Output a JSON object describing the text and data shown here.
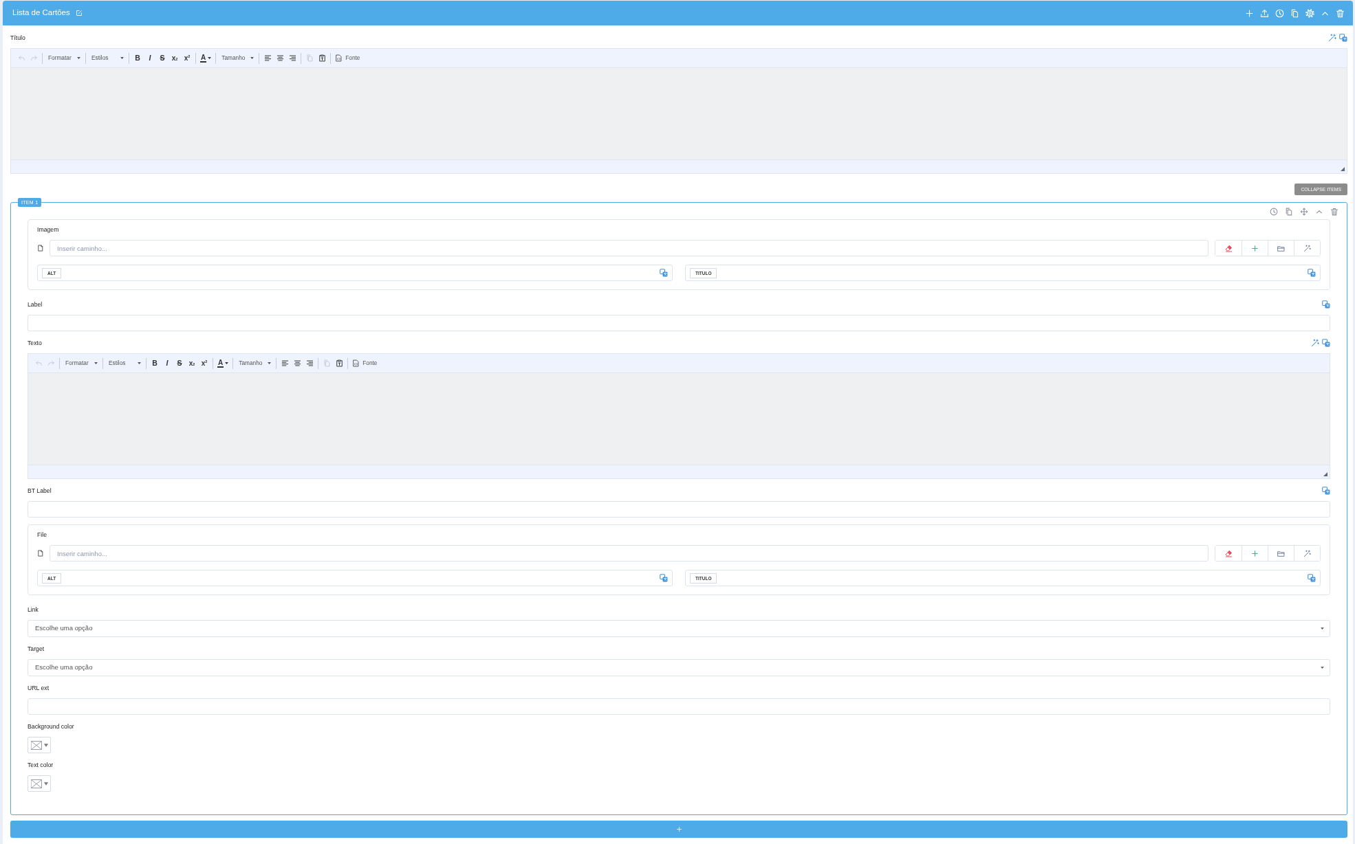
{
  "panel": {
    "title": "Lista de Cartões"
  },
  "title_field": {
    "label": "Título",
    "wand": true,
    "translate": true,
    "editor": {
      "toolbar": [
        [
          {
            "kind": "undo",
            "disabled": true
          },
          {
            "kind": "redo",
            "disabled": true
          }
        ],
        [
          {
            "kind": "combo",
            "label": "Formatar",
            "disabled": false
          }
        ],
        [
          {
            "kind": "combo",
            "label": "Estilos",
            "disabled": false
          }
        ],
        [
          {
            "kind": "bold",
            "text": "B",
            "disabled": false
          },
          {
            "kind": "italic",
            "text": "I",
            "disabled": false
          },
          {
            "kind": "strike",
            "text": "S",
            "disabled": false
          },
          {
            "kind": "subscript",
            "text": "x$_{2}$",
            "disabled": false
          },
          {
            "kind": "superscript",
            "text": "x$^{2}$",
            "disabled": false
          }
        ],
        [
          {
            "kind": "text-color",
            "text": "A",
            "disabled": false
          }
        ],
        [
          {
            "kind": "combo",
            "label": "Tamanho",
            "disabled": false
          }
        ],
        [
          {
            "kind": "align-left",
            "disabled": false
          },
          {
            "kind": "align-center",
            "disabled": false
          },
          {
            "kind": "align-right",
            "disabled": false
          }
        ],
        [
          {
            "kind": "copy",
            "disabled": true
          },
          {
            "kind": "paste-text",
            "disabled": false
          }
        ],
        [
          {
            "kind": "source",
            "label": "Fonte",
            "disabled": false
          }
        ]
      ]
    }
  },
  "collapse_button": "COLLAPSE ITEMS",
  "items": [
    {
      "legend": "ITEM 1",
      "fields": [
        {
          "kind": "media",
          "label": "Imagem",
          "placeholder": "Inserir caminho...",
          "alt_tag": "ALT",
          "title_tag": "TITULO"
        },
        {
          "kind": "text",
          "label": "Label",
          "wand": false,
          "translate": true
        },
        {
          "kind": "editor",
          "label": "Texto",
          "wand": true,
          "translate": true,
          "editor": {
            "toolbar": [
              [
                {
                  "kind": "undo",
                  "disabled": true
                },
                {
                  "kind": "redo",
                  "disabled": true
                }
              ],
              [
                {
                  "kind": "combo",
                  "label": "Formatar",
                  "disabled": false
                }
              ],
              [
                {
                  "kind": "combo",
                  "label": "Estilos",
                  "disabled": false
                }
              ],
              [
                {
                  "kind": "bold",
                  "text": "B",
                  "disabled": false
                },
                {
                  "kind": "italic",
                  "text": "I",
                  "disabled": false
                },
                {
                  "kind": "strike",
                  "text": "S",
                  "disabled": false
                },
                {
                  "kind": "subscript",
                  "text": "x$_{2}$",
                  "disabled": false
                },
                {
                  "kind": "superscript",
                  "text": "x$^{2}$",
                  "disabled": false
                }
              ],
              [
                {
                  "kind": "text-color",
                  "text": "A",
                  "disabled": false
                }
              ],
              [
                {
                  "kind": "combo",
                  "label": "Tamanho",
                  "disabled": false
                }
              ],
              [
                {
                  "kind": "align-left",
                  "disabled": false
                },
                {
                  "kind": "align-center",
                  "disabled": false
                },
                {
                  "kind": "align-right",
                  "disabled": false
                }
              ],
              [
                {
                  "kind": "copy",
                  "disabled": true
                },
                {
                  "kind": "paste-text",
                  "disabled": false
                }
              ],
              [
                {
                  "kind": "source",
                  "label": "Fonte",
                  "disabled": false
                }
              ]
            ]
          }
        },
        {
          "kind": "text",
          "label": "BT Label",
          "wand": false,
          "translate": true
        },
        {
          "kind": "media",
          "label": "File",
          "placeholder": "Inserir caminho...",
          "alt_tag": "ALT",
          "title_tag": "TITULO"
        },
        {
          "kind": "select",
          "label": "Link",
          "placeholder": "Escolhe uma opção"
        },
        {
          "kind": "select",
          "label": "Target",
          "placeholder": "Escolhe uma opção"
        },
        {
          "kind": "text",
          "label": "URL ext",
          "wand": false,
          "translate": false
        },
        {
          "kind": "color",
          "label": "Background color"
        },
        {
          "kind": "color",
          "label": "Text color"
        }
      ]
    }
  ]
}
